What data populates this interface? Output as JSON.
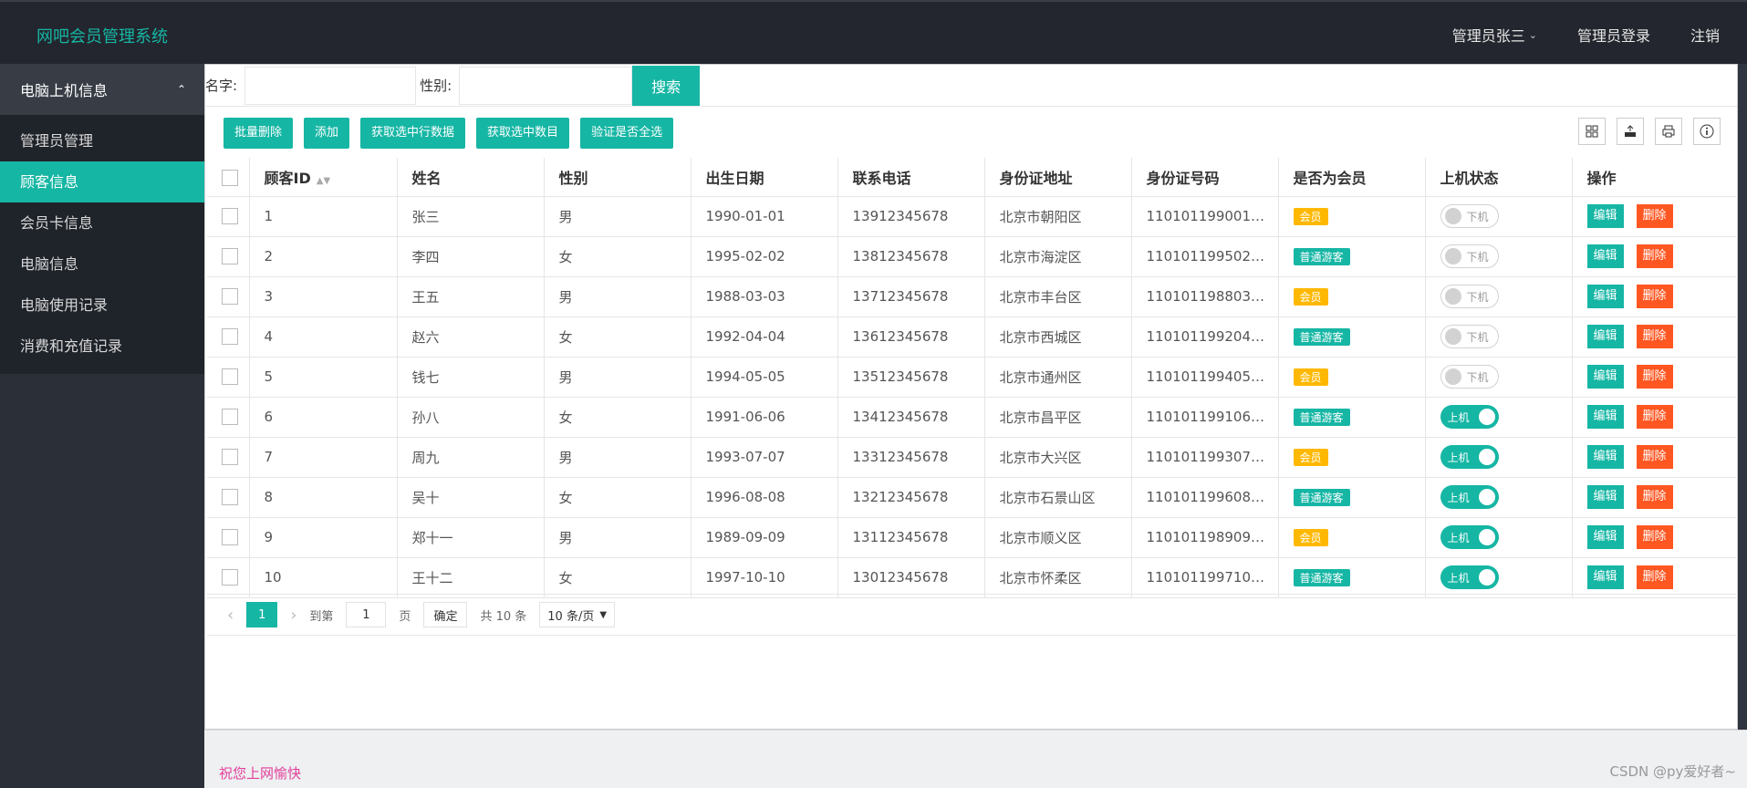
{
  "header": {
    "title": "网吧会员管理系统",
    "admin_name": "管理员张三",
    "login_link": "管理员登录",
    "logout_link": "注销"
  },
  "sidebar": {
    "group_label": "电脑上机信息",
    "items": [
      {
        "label": "管理员管理"
      },
      {
        "label": "顾客信息"
      },
      {
        "label": "会员卡信息"
      },
      {
        "label": "电脑信息"
      },
      {
        "label": "电脑使用记录"
      },
      {
        "label": "消费和充值记录"
      }
    ]
  },
  "search": {
    "name_label": "名字:",
    "name_value": "",
    "gender_label": "性别:",
    "gender_value": "",
    "button": "搜索"
  },
  "toolbar": {
    "batch_delete": "批量删除",
    "add": "添加",
    "get_selected_rows": "获取选中行数据",
    "get_selected_count": "获取选中数目",
    "check_all": "验证是否全选",
    "icons": [
      "grid-icon",
      "export-icon",
      "print-icon",
      "info-icon"
    ]
  },
  "table": {
    "columns": [
      "顾客ID",
      "姓名",
      "性别",
      "出生日期",
      "联系电话",
      "身份证地址",
      "身份证号码",
      "是否为会员",
      "上机状态",
      "操作"
    ],
    "rows": [
      {
        "id": "1",
        "name": "张三",
        "gender": "男",
        "birth": "1990-01-01",
        "phone": "13912345678",
        "address": "北京市朝阳区",
        "idno": "110101199001…",
        "member": "会员",
        "status": "下机"
      },
      {
        "id": "2",
        "name": "李四",
        "gender": "女",
        "birth": "1995-02-02",
        "phone": "13812345678",
        "address": "北京市海淀区",
        "idno": "110101199502…",
        "member": "普通游客",
        "status": "下机"
      },
      {
        "id": "3",
        "name": "王五",
        "gender": "男",
        "birth": "1988-03-03",
        "phone": "13712345678",
        "address": "北京市丰台区",
        "idno": "110101198803…",
        "member": "会员",
        "status": "下机"
      },
      {
        "id": "4",
        "name": "赵六",
        "gender": "女",
        "birth": "1992-04-04",
        "phone": "13612345678",
        "address": "北京市西城区",
        "idno": "110101199204…",
        "member": "普通游客",
        "status": "下机"
      },
      {
        "id": "5",
        "name": "钱七",
        "gender": "男",
        "birth": "1994-05-05",
        "phone": "13512345678",
        "address": "北京市通州区",
        "idno": "110101199405…",
        "member": "会员",
        "status": "下机"
      },
      {
        "id": "6",
        "name": "孙八",
        "gender": "女",
        "birth": "1991-06-06",
        "phone": "13412345678",
        "address": "北京市昌平区",
        "idno": "110101199106…",
        "member": "普通游客",
        "status": "上机"
      },
      {
        "id": "7",
        "name": "周九",
        "gender": "男",
        "birth": "1993-07-07",
        "phone": "13312345678",
        "address": "北京市大兴区",
        "idno": "110101199307…",
        "member": "会员",
        "status": "上机"
      },
      {
        "id": "8",
        "name": "吴十",
        "gender": "女",
        "birth": "1996-08-08",
        "phone": "13212345678",
        "address": "北京市石景山区",
        "idno": "110101199608…",
        "member": "普通游客",
        "status": "上机"
      },
      {
        "id": "9",
        "name": "郑十一",
        "gender": "男",
        "birth": "1989-09-09",
        "phone": "13112345678",
        "address": "北京市顺义区",
        "idno": "110101198909…",
        "member": "会员",
        "status": "上机"
      },
      {
        "id": "10",
        "name": "王十二",
        "gender": "女",
        "birth": "1997-10-10",
        "phone": "13012345678",
        "address": "北京市怀柔区",
        "idno": "110101199710…",
        "member": "普通游客",
        "status": "上机"
      }
    ],
    "edit_label": "编辑",
    "delete_label": "删除"
  },
  "pager": {
    "current": "1",
    "goto_label": "到第",
    "goto_value": "1",
    "page_label": "页",
    "confirm": "确定",
    "total": "共 10 条",
    "page_size": "10 条/页"
  },
  "footer": {
    "left_text": "祝您上网愉快",
    "right_text": "CSDN @py爱好者~"
  }
}
